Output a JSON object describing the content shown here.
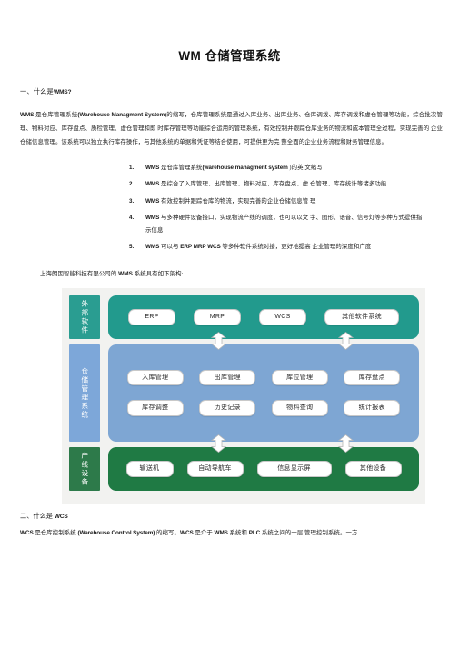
{
  "document": {
    "title": "WM 仓储管理系统"
  },
  "section1": {
    "heading_prefix": "一、什么是",
    "heading_term": "WMS?",
    "paragraph": {
      "lead_term": "WMS",
      "text_a": " 是仓库管理系统",
      "english": "(Warehouse Managment System)",
      "text_b": "的缩写，仓库管理系统是通过入库业务、出库业务、仓库调拨、库存调拨和虚仓管理等功能，综合批次管理、物料对应、库存盘点、质检管理、虚仓管理和即 时库存管理等功能综合运用的管理系统，有效控制并跟踪仓库业务的物流和成本管理全过程，实现完善的 企业仓储信息管理。该系统可以独立执行库存操作，与其他系统的单据和凭证等结合使用，可提供更为完 整全面的企业业务流程和财务管理信息。"
    },
    "list": [
      {
        "term": "WMS",
        "text_a": " 是仓库管理系统",
        "english": "(warehouse managment system",
        "text_b": " )的英 文缩写"
      },
      {
        "term": "WMS",
        "text_a": " 是综合了入库管理、出库管理、物料对应、库存盘点、虚 仓管理、库存统计等诸多功能",
        "english": "",
        "text_b": ""
      },
      {
        "term": "WMS",
        "text_a": " 有效控制并跟踪仓库的物流，实现完善的企业仓储信息管 理",
        "english": "",
        "text_b": ""
      },
      {
        "term": "WMS",
        "text_a": " 与多种硬件设备接口，实现物流产线的调度，也可以以文 字、图形、语音、信号灯等多种方式提供指示信息",
        "english": "",
        "text_b": ""
      },
      {
        "term": "WMS",
        "text_a": " 可以与 ",
        "english": "ERP MRP WCS",
        "text_b": " 等多种软件系统对接，更好地提高 企业管理的深度和广度"
      }
    ],
    "caption": {
      "text_a": "上海朗因智能科技有限公司的 ",
      "term": "WMS",
      "text_b": " 系统具有如下架构:"
    }
  },
  "diagram": {
    "tiers": [
      {
        "label": "外部软件",
        "color": "#229a8d",
        "label_color": "#2a9d91",
        "rows": [
          [
            {
              "text": "ERP",
              "size": "w-sm"
            },
            {
              "text": "MRP",
              "size": "w-sm"
            },
            {
              "text": "WCS",
              "size": "w-sm"
            },
            {
              "text": "其他软件系统",
              "size": "w-lg"
            }
          ]
        ]
      },
      {
        "label": "仓储管理系统",
        "color": "#7ea6d3",
        "label_color": "#7da7d9",
        "rows": [
          [
            {
              "text": "入库管理",
              "size": "w-md"
            },
            {
              "text": "出库管理",
              "size": "w-md"
            },
            {
              "text": "库位管理",
              "size": "w-md"
            },
            {
              "text": "库存盘点",
              "size": "w-md"
            }
          ],
          [
            {
              "text": "库存调整",
              "size": "w-md"
            },
            {
              "text": "历史记录",
              "size": "w-md"
            },
            {
              "text": "物料查询",
              "size": "w-md"
            },
            {
              "text": "统计报表",
              "size": "w-md"
            }
          ]
        ]
      },
      {
        "label": "产线设备",
        "color": "#1f7a44",
        "label_color": "#2d7a4a",
        "rows": [
          [
            {
              "text": "输送机",
              "size": "w-sm"
            },
            {
              "text": "自动导航车",
              "size": "w-md"
            },
            {
              "text": "信息显示屏",
              "size": "w-lg"
            },
            {
              "text": "其他设备",
              "size": "w-md"
            }
          ]
        ]
      }
    ]
  },
  "section2": {
    "heading_prefix": "二、什么是 ",
    "heading_term": "WCS",
    "paragraph": {
      "lead_term": "WCS",
      "text_a": " 是仓库控制系统 ",
      "english": "(Warehouse Control System)",
      "text_b": " 的缩写。",
      "term2": "WCS",
      "text_c": " 是介于 ",
      "term3": "WMS",
      "text_d": " 系统和 ",
      "term4": "PLC",
      "text_e": " 系统之间的一层 管理控制系统。一方"
    }
  }
}
